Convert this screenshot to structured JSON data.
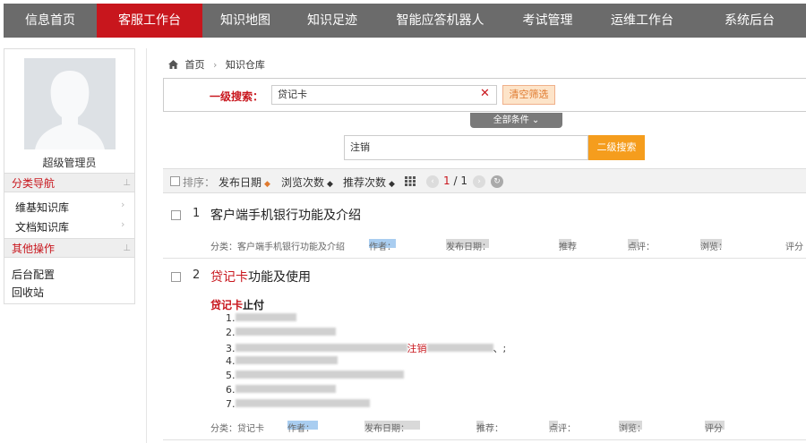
{
  "nav": {
    "items": [
      {
        "label": "信息首页",
        "active": false
      },
      {
        "label": "客服工作台",
        "active": true
      },
      {
        "label": "知识地图",
        "active": false
      },
      {
        "label": "知识足迹",
        "active": false
      },
      {
        "label": "智能应答机器人",
        "active": false
      },
      {
        "label": "考试管理",
        "active": false
      },
      {
        "label": "运维工作台",
        "active": false
      },
      {
        "label": "系统后台",
        "active": false
      }
    ],
    "active_color": "#c8161d",
    "bg_color": "#6b6b6b"
  },
  "sidebar": {
    "username": "超级管理员",
    "category_nav_title": "分类导航",
    "category_items": [
      {
        "label": "维基知识库"
      },
      {
        "label": "文档知识库"
      }
    ],
    "other_title": "其他操作",
    "other_items": [
      {
        "label": "后台配置"
      },
      {
        "label": "回收站"
      }
    ]
  },
  "breadcrumb": {
    "home": "首页",
    "current": "知识仓库"
  },
  "search": {
    "level1_label": "一级搜索：",
    "level1_value": "贷记卡",
    "clear_label": "清空筛选",
    "all_conditions_label": "全部条件",
    "level2_value": "注销",
    "level2_button": "二级搜索"
  },
  "sortbar": {
    "sort_label": "排序：",
    "publish_date": "发布日期",
    "view_count": "浏览次数",
    "recommend_count": "推荐次数",
    "page_current": "1",
    "page_total": "/ 1"
  },
  "results": [
    {
      "num": "1",
      "title": "客户端手机银行功能及介绍",
      "meta_category": "分类：客户端手机银行功能及介绍",
      "meta_author": "作者：",
      "meta_date": "发布日期：",
      "meta_recommend": "推荐",
      "meta_comment": "点评：",
      "meta_views": "浏览：",
      "meta_score": "评分"
    },
    {
      "num": "2",
      "title_hl": "贷记卡",
      "title_rest": "功能及使用",
      "snippet_hl": "贷记卡",
      "snippet_rest": "止付",
      "snippet_lines": [
        "1.",
        "2.",
        "3.",
        "4.",
        "5.",
        "6.",
        "7."
      ],
      "snippet_keyword": "注销",
      "meta_category": "分类：贷记卡",
      "meta_author": "作者：",
      "meta_date": "发布日期：",
      "meta_recommend": "推荐：",
      "meta_comment": "点评：",
      "meta_views": "浏览：",
      "meta_score": "评分"
    }
  ]
}
